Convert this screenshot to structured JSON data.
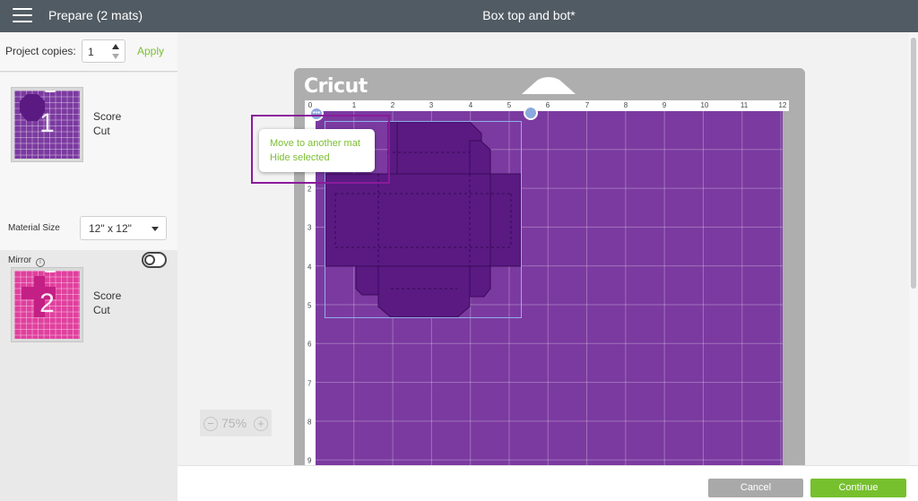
{
  "header": {
    "title": "Prepare (2 mats)",
    "project_name": "Box top and bot*"
  },
  "copies": {
    "label": "Project copies:",
    "value": "1",
    "apply_label": "Apply"
  },
  "mats": [
    {
      "number": "1",
      "operations": [
        "Score",
        "Cut"
      ],
      "color": "#7b3aa0"
    },
    {
      "number": "2",
      "operations": [
        "Score",
        "Cut"
      ],
      "color": "#e0409e"
    }
  ],
  "material": {
    "label": "Material Size",
    "value": "12\" x 12\""
  },
  "mirror": {
    "label": "Mirror",
    "on": false
  },
  "ruler": {
    "top_ticks": [
      "0",
      "1",
      "2",
      "3",
      "4",
      "5",
      "6",
      "7",
      "8",
      "9",
      "10",
      "11",
      "12"
    ],
    "left_ticks": [
      "2",
      "3",
      "4",
      "5",
      "6",
      "7",
      "8",
      "9"
    ]
  },
  "brand": {
    "logo_text": "Cricut"
  },
  "context_menu": {
    "items": [
      "Move to another mat",
      "Hide selected"
    ]
  },
  "zoom": {
    "value": "75%"
  },
  "footer": {
    "cancel_label": "Cancel",
    "continue_label": "Continue"
  },
  "colors": {
    "accent_green": "#76c02e",
    "mat_purple": "#7b3aa0",
    "design_purple": "#5a1a82",
    "mat_pink": "#e0409e",
    "header_gray": "#515b63"
  }
}
